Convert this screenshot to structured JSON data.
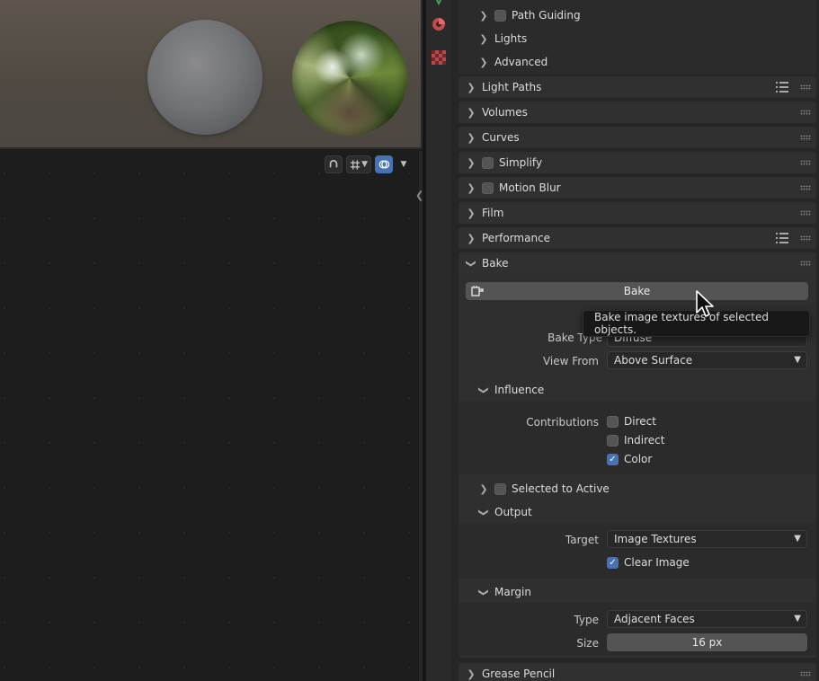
{
  "properties": {
    "top_subpanels": [
      {
        "label": "Path Guiding",
        "has_checkbox": true
      },
      {
        "label": "Lights",
        "has_checkbox": false
      },
      {
        "label": "Advanced",
        "has_checkbox": false
      }
    ],
    "panels": [
      {
        "label": "Light Paths",
        "has_checkbox": false,
        "has_list_icon": true
      },
      {
        "label": "Volumes",
        "has_checkbox": false,
        "has_list_icon": false
      },
      {
        "label": "Curves",
        "has_checkbox": false,
        "has_list_icon": false
      },
      {
        "label": "Simplify",
        "has_checkbox": true,
        "has_list_icon": false
      },
      {
        "label": "Motion Blur",
        "has_checkbox": true,
        "has_list_icon": false
      },
      {
        "label": "Film",
        "has_checkbox": false,
        "has_list_icon": false
      },
      {
        "label": "Performance",
        "has_checkbox": false,
        "has_list_icon": true
      }
    ],
    "bake": {
      "panel_label": "Bake",
      "bake_button": "Bake",
      "bake_type_label": "Bake Type",
      "bake_type_value": "Diffuse",
      "view_from_label": "View From",
      "view_from_value": "Above Surface",
      "influence": {
        "label": "Influence",
        "contributions_label": "Contributions",
        "direct": {
          "label": "Direct",
          "checked": false
        },
        "indirect": {
          "label": "Indirect",
          "checked": false
        },
        "color": {
          "label": "Color",
          "checked": true
        }
      },
      "selected_to_active": {
        "label": "Selected to Active",
        "checked": false
      },
      "output": {
        "label": "Output",
        "target_label": "Target",
        "target_value": "Image Textures",
        "clear_image": {
          "label": "Clear Image",
          "checked": true
        }
      },
      "margin": {
        "label": "Margin",
        "type_label": "Type",
        "type_value": "Adjacent Faces",
        "size_label": "Size",
        "size_value": "16 px"
      }
    },
    "grease_pencil": {
      "label": "Grease Pencil"
    }
  },
  "tooltip": {
    "text": "Bake image textures of selected objects."
  },
  "colors": {
    "accent": "#4772b3",
    "panel_bg": "#303030",
    "editor_bg": "#1d1d1d"
  },
  "icons": [
    "chevron-right-icon",
    "chevron-down-icon",
    "checkbox-icon",
    "list-icon",
    "grip-icon",
    "world-icon",
    "texture-icon",
    "camera-icon",
    "overlay-icon",
    "snap-icon",
    "mouse-cursor-icon"
  ]
}
